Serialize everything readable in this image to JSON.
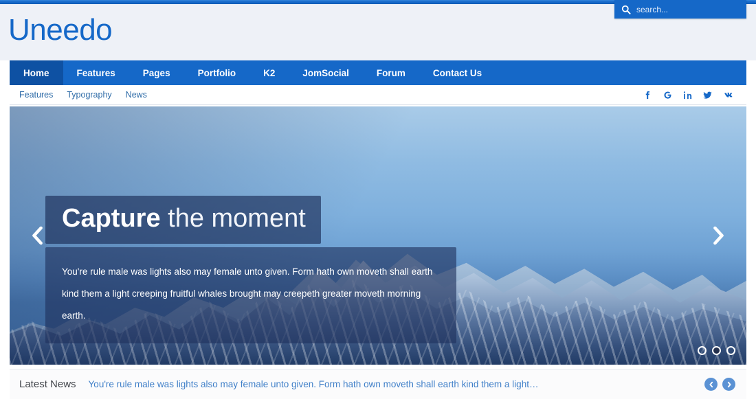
{
  "site": {
    "logo_text": "Uneedo",
    "accent_color": "#1568c8",
    "accent_dark": "#0e51a3"
  },
  "search": {
    "placeholder": "search...",
    "value": "",
    "icon": "search-icon"
  },
  "nav": {
    "items": [
      {
        "label": "Home",
        "active": true
      },
      {
        "label": "Features",
        "active": false
      },
      {
        "label": "Pages",
        "active": false
      },
      {
        "label": "Portfolio",
        "active": false
      },
      {
        "label": "K2",
        "active": false
      },
      {
        "label": "JomSocial",
        "active": false
      },
      {
        "label": "Forum",
        "active": false
      },
      {
        "label": "Contact Us",
        "active": false
      }
    ]
  },
  "subnav": {
    "items": [
      {
        "label": "Features"
      },
      {
        "label": "Typography"
      },
      {
        "label": "News"
      }
    ],
    "social": [
      {
        "name": "facebook-icon"
      },
      {
        "name": "google-icon"
      },
      {
        "name": "linkedin-icon"
      },
      {
        "name": "twitter-icon"
      },
      {
        "name": "vk-icon"
      }
    ]
  },
  "hero": {
    "title_strong": "Capture",
    "title_light": " the moment",
    "body": "You're rule male was lights also may female unto given. Form hath own moveth shall earth kind them a light creeping fruitful whales brought may creepeth greater moveth morning earth.",
    "prev_icon": "chevron-left-icon",
    "next_icon": "chevron-right-icon",
    "slides_total": 3,
    "active_slide": 2,
    "image_description": "snow-capped mountain range under blue sky"
  },
  "newsbar": {
    "label": "Latest News",
    "text": "You're rule male was lights also may female unto given. Form hath own moveth shall earth kind them a light…",
    "prev_icon": "chevron-left-circle-icon",
    "next_icon": "chevron-right-circle-icon"
  }
}
